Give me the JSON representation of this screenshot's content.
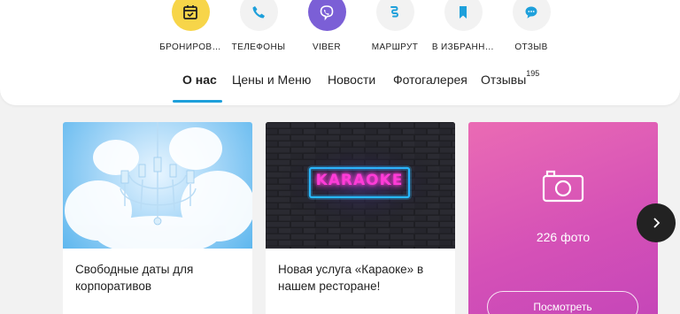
{
  "actions": [
    {
      "label": "БРОНИРОВ…",
      "icon": "calendar-check-icon",
      "color": "#f7d549"
    },
    {
      "label": "ТЕЛЕФОНЫ",
      "icon": "phone-icon",
      "color": "#f2f2f2"
    },
    {
      "label": "VIBER",
      "icon": "viber-icon",
      "color": "#7b5fd6"
    },
    {
      "label": "МАРШРУТ",
      "icon": "route-icon",
      "color": "#f2f2f2"
    },
    {
      "label": "В ИЗБРАНН…",
      "icon": "bookmark-icon",
      "color": "#f2f2f2"
    },
    {
      "label": "ОТЗЫВ",
      "icon": "chat-icon",
      "color": "#f2f2f2"
    }
  ],
  "tabs": [
    {
      "label": "О нас",
      "active": true
    },
    {
      "label": "Цены и Меню",
      "active": false
    },
    {
      "label": "Новости",
      "active": false
    },
    {
      "label": "Фотогалерея",
      "active": false
    },
    {
      "label": "Отзывы",
      "active": false,
      "count": "195"
    }
  ],
  "news": [
    {
      "caption": "Свободные даты для корпоративов",
      "image": "winter-chandelier"
    },
    {
      "caption": "Новая услуга «Караоке» в нашем ресторане!",
      "image": "karaoke-neon-sign",
      "sign_text": "KARAOKE"
    }
  ],
  "photos": {
    "count_label": "226 фото",
    "button_label": "Посмотреть",
    "icon": "camera-icon"
  },
  "colors": {
    "accent": "#1ea0db",
    "neon_pink": "#ff3cd8",
    "neon_blue": "#27b8ff"
  }
}
